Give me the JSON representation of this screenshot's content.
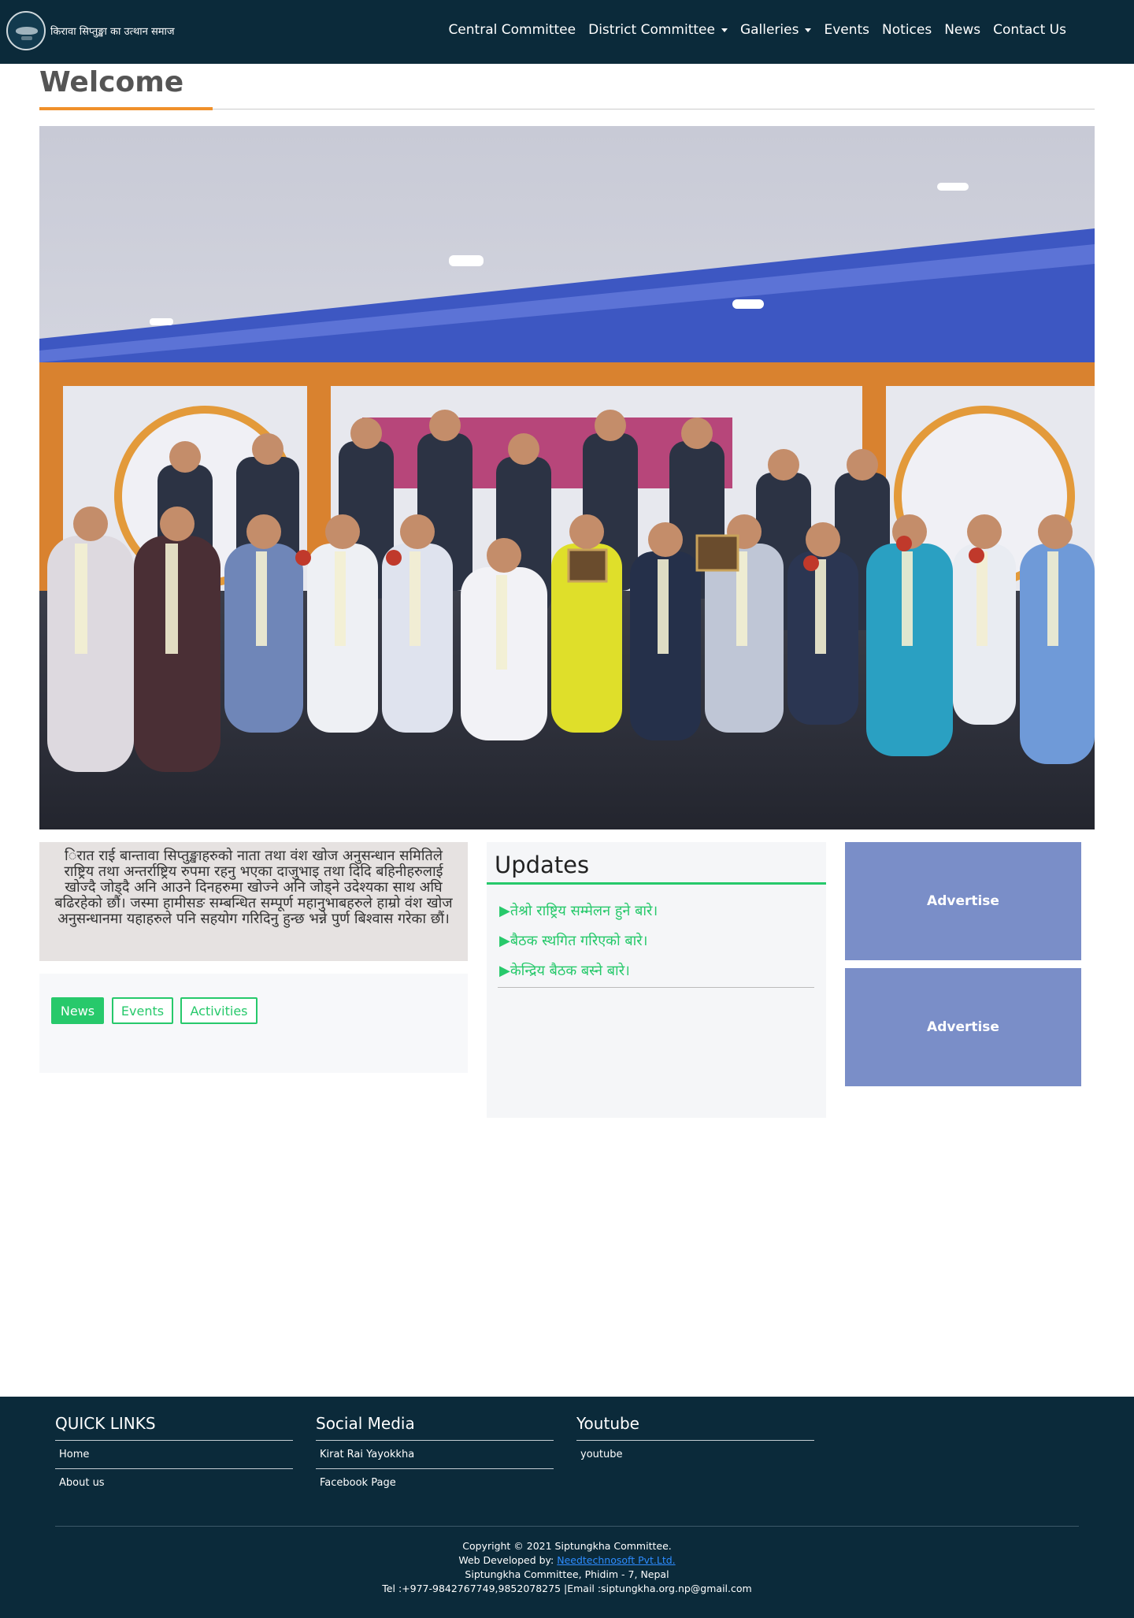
{
  "brand": {
    "name": "किरावा सिप्तुङ्खा का उत्थान समाज",
    "logo_icon": "organization-seal-logo"
  },
  "nav": {
    "items": [
      {
        "label": "Central Committee",
        "dropdown": false
      },
      {
        "label": "District Committee",
        "dropdown": true
      },
      {
        "label": "Galleries",
        "dropdown": true
      },
      {
        "label": "Events",
        "dropdown": false
      },
      {
        "label": "Notices",
        "dropdown": false
      },
      {
        "label": "News",
        "dropdown": false
      },
      {
        "label": "Contact Us",
        "dropdown": false
      }
    ]
  },
  "welcome": {
    "title": "Welcome"
  },
  "intro": {
    "text": "िरात राई बान्तावा सिप्तुङ्खाहरुको नाता तथा वंश खोज अनुसन्धान समितिले राष्ट्रिय तथा अन्तर्राष्ट्रिय रुपमा रहनु भएका दाजुभाइ तथा दिदि बहिनीहरुलाई खोज्दै जोड्दै अनि आउने दिनहरुमा खोज्ने अनि जोड्ने उदेश्यका साथ अघि बढिरहेको छौं। जस्मा हामीसङ सम्बन्धित सम्पूर्ण महानुभाबहरुले हाम्रो वंश खोज अनुसन्धानमा यहाहरुले पनि सहयोग गरिदिनु हुन्छ भन्ने पुर्ण बिश्वास गरेका छौं।"
  },
  "tabs": {
    "items": [
      "News",
      "Events",
      "Activities"
    ],
    "active": "News"
  },
  "updates": {
    "title": "Updates",
    "items": [
      "तेश्रो राष्ट्रिय सम्मेलन हुने बारे।",
      "बैठक स्थगित गरिएको बारे।",
      "केन्द्रिय बैठक बस्ने बारे।"
    ]
  },
  "ads": [
    "Advertise",
    "Advertise"
  ],
  "footer": {
    "quick_links": {
      "title": "QUICK LINKS",
      "items": [
        "Home",
        "About us"
      ]
    },
    "social": {
      "title": "Social Media",
      "items": [
        "Kirat Rai Yayokkha",
        "Facebook Page"
      ]
    },
    "youtube": {
      "title": "Youtube",
      "items": [
        "youtube"
      ]
    },
    "copyright": "Copyright © 2021 Siptungkha Committee.",
    "developed_prefix": "Web Developed by:",
    "developer": "Needtechnosoft Pvt.Ltd.",
    "address": "Siptungkha Committee, Phidim - 7, Nepal",
    "contact": "Tel :+977-9842767749,9852078275 |Email :siptungkha.org.np@gmail.com"
  },
  "colors": {
    "navbar_bg": "#0b2a3a",
    "accent_orange": "#f0902a",
    "accent_green": "#27c96b",
    "advert_bg": "#7a8ec8",
    "intro_bg": "#e6e2e1"
  }
}
